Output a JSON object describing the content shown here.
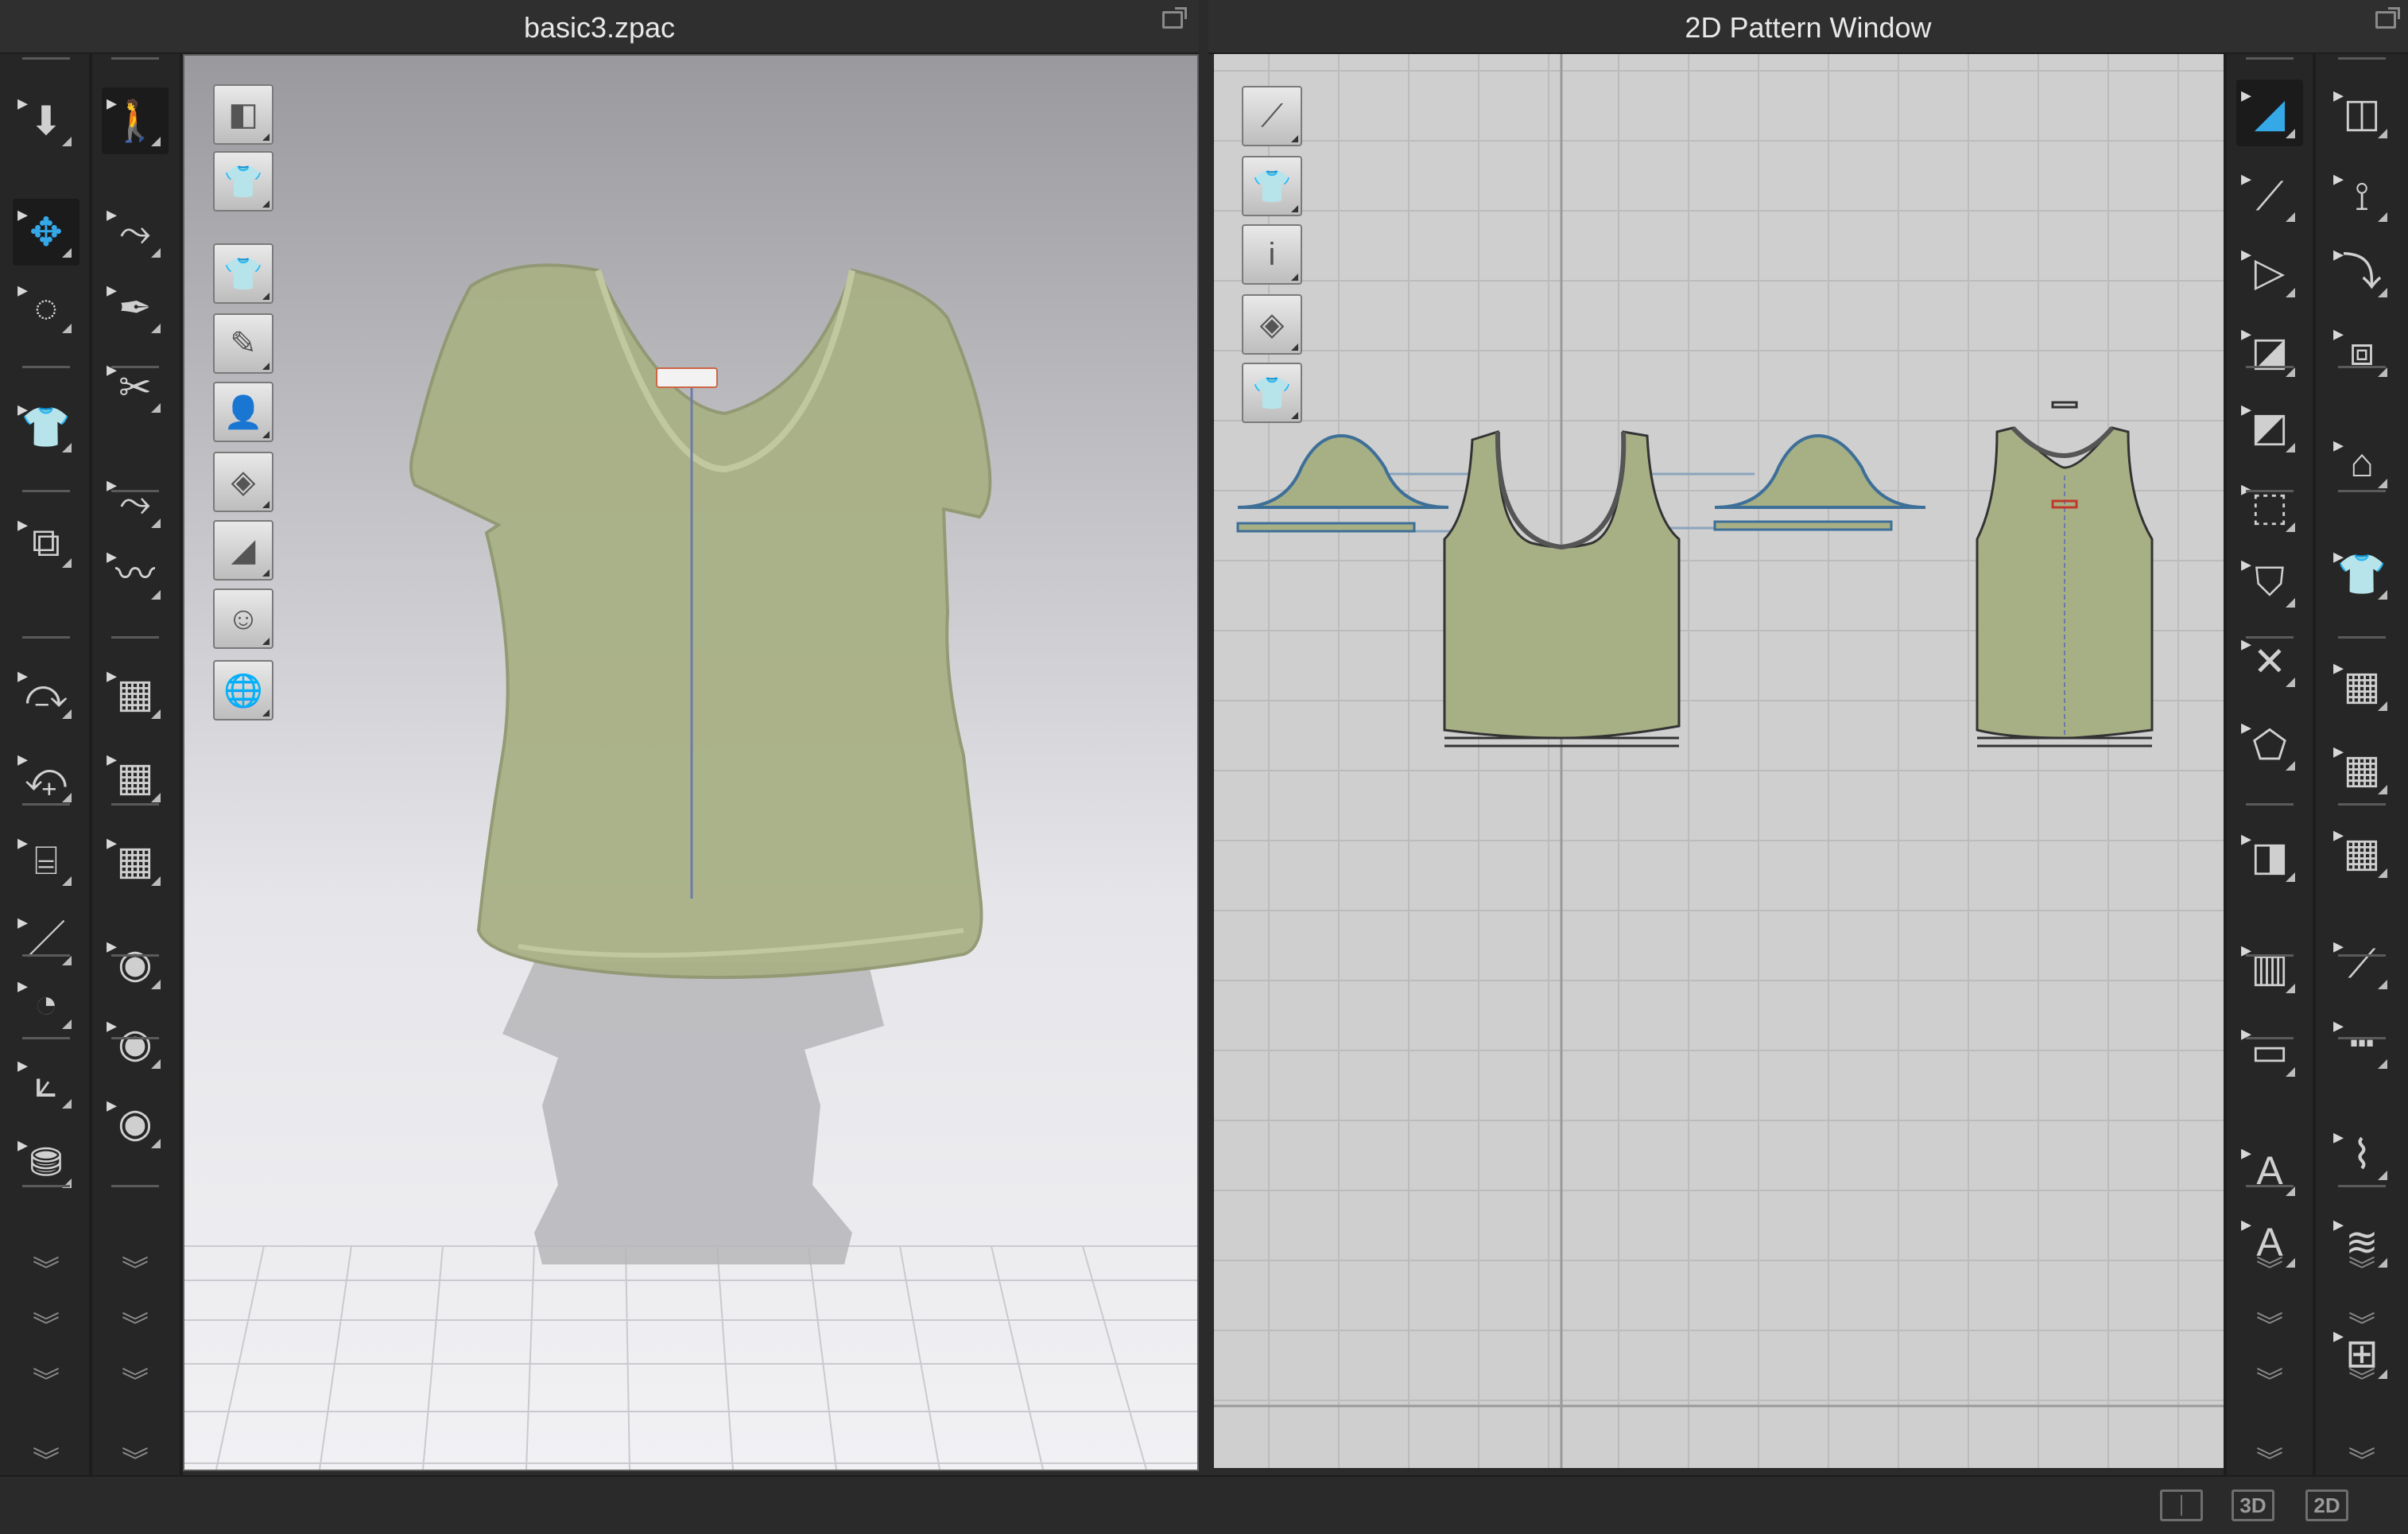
{
  "window_3d": {
    "title": "basic3.zpac"
  },
  "window_2d": {
    "title": "2D Pattern Window"
  },
  "toolbar_3d_left": [
    {
      "name": "simulation-icon",
      "glyph": "⬇"
    },
    {
      "name": "select-move-icon",
      "glyph": "✥"
    },
    {
      "name": "lasso-select-icon",
      "glyph": "◌"
    },
    {
      "name": "garment-icon",
      "glyph": "👕"
    },
    {
      "name": "fold-arrangement-icon",
      "glyph": "⧉"
    },
    {
      "name": "tack-icon",
      "glyph": "⤼"
    },
    {
      "name": "tack-on-avatar-icon",
      "glyph": "⤽"
    },
    {
      "name": "sewing-machine-icon",
      "glyph": "⌸"
    },
    {
      "name": "pen-icon",
      "glyph": "／"
    },
    {
      "name": "steam-icon",
      "glyph": "◔"
    },
    {
      "name": "fold-icon",
      "glyph": "⟀"
    },
    {
      "name": "avatar-box-icon",
      "glyph": "⛃"
    }
  ],
  "toolbar_3d_right": [
    {
      "name": "walk-icon",
      "glyph": "🚶"
    },
    {
      "name": "edit-pattern-3d-icon",
      "glyph": "⤳"
    },
    {
      "name": "3d-pen-icon",
      "glyph": "✒"
    },
    {
      "name": "cut-icon",
      "glyph": "✂"
    },
    {
      "name": "shape-edit-icon",
      "glyph": "⤳"
    },
    {
      "name": "curve-edit-icon",
      "glyph": "〰"
    },
    {
      "name": "texture-edit-icon",
      "glyph": "▦"
    },
    {
      "name": "texture-transform-icon",
      "glyph": "▦"
    },
    {
      "name": "checker-shirt-icon",
      "glyph": "▦"
    },
    {
      "name": "button-icon",
      "glyph": "◉"
    },
    {
      "name": "buttonhole-icon",
      "glyph": "◉"
    },
    {
      "name": "lock-button-icon",
      "glyph": "◉"
    }
  ],
  "viewport_tools_3d": [
    {
      "name": "view-box-icon",
      "glyph": "◧"
    },
    {
      "name": "view-shirt-icon",
      "glyph": "👕"
    },
    {
      "name": "show-garment-icon",
      "glyph": "👕"
    },
    {
      "name": "show-pins-icon",
      "glyph": "✎"
    },
    {
      "name": "show-avatar-icon",
      "glyph": "👤"
    },
    {
      "name": "fabric-render-icon",
      "glyph": "◈"
    },
    {
      "name": "surface-icon",
      "glyph": "◢"
    },
    {
      "name": "avatar-skin-icon",
      "glyph": "☺"
    },
    {
      "name": "environment-icon",
      "glyph": "🌐"
    }
  ],
  "viewport_tools_2d": [
    {
      "name": "show-seamline-icon",
      "glyph": "⟋"
    },
    {
      "name": "show-pattern-icon",
      "glyph": "👕"
    },
    {
      "name": "info-icon",
      "glyph": "i"
    },
    {
      "name": "fabric-view-icon",
      "glyph": "◈"
    },
    {
      "name": "lock-pattern-icon",
      "glyph": "👕"
    }
  ],
  "toolbar_2d_left": [
    {
      "name": "transform-pattern-icon",
      "glyph": "◢"
    },
    {
      "name": "edit-point-icon",
      "glyph": "⟋"
    },
    {
      "name": "edit-curvature-icon",
      "glyph": "▷"
    },
    {
      "name": "polygon-icon",
      "glyph": "◪"
    },
    {
      "name": "rectangle-icon",
      "glyph": "◩"
    },
    {
      "name": "internal-polygon-icon",
      "glyph": "⬚"
    },
    {
      "name": "dart-icon",
      "glyph": "⛉"
    },
    {
      "name": "cross-line-icon",
      "glyph": "✕"
    },
    {
      "name": "trace-icon",
      "glyph": "⬠"
    },
    {
      "name": "grading-icon",
      "glyph": "◨"
    },
    {
      "name": "ruler-icon",
      "glyph": "▥"
    },
    {
      "name": "tape-icon",
      "glyph": "▭"
    },
    {
      "name": "text-icon",
      "glyph": "A"
    },
    {
      "name": "text-edit-icon",
      "glyph": "A"
    }
  ],
  "toolbar_2d_right": [
    {
      "name": "edit-point-alt-icon",
      "glyph": "◫"
    },
    {
      "name": "add-point-icon",
      "glyph": "⟟"
    },
    {
      "name": "curve-point-icon",
      "glyph": "⤵"
    },
    {
      "name": "seam-icon",
      "glyph": "⧈"
    },
    {
      "name": "iron-icon",
      "glyph": "⌂"
    },
    {
      "name": "fold-pattern-icon",
      "glyph": "👕"
    },
    {
      "name": "texture-2d-icon",
      "glyph": "▦"
    },
    {
      "name": "texture-2d-transform-icon",
      "glyph": "▦"
    },
    {
      "name": "checker-2d-icon",
      "glyph": "▦"
    },
    {
      "name": "segment-sewing-icon",
      "glyph": "⟋"
    },
    {
      "name": "free-sewing-icon",
      "glyph": "┅"
    },
    {
      "name": "elastic-icon",
      "glyph": "⌇"
    },
    {
      "name": "stitch-icon",
      "glyph": "≋"
    },
    {
      "name": "avatar-add-icon",
      "glyph": "⊞"
    }
  ],
  "view_modes": {
    "split": "",
    "three_d": "3D",
    "two_d": "2D"
  }
}
